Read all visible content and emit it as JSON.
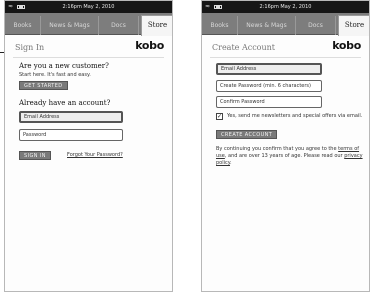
{
  "status": {
    "time": "2:16pm",
    "date": "May 2, 2010"
  },
  "tabs": [
    "Books",
    "News & Mags",
    "Docs",
    "Store"
  ],
  "brand": "kobo",
  "sign_in": {
    "title": "Sign In",
    "new_heading": "Are you a new customer?",
    "new_sub": "Start here. It's fast and easy.",
    "get_started": "GET STARTED",
    "have_heading": "Already have an account?",
    "email_placeholder": "Email Address",
    "password_placeholder": "Password",
    "sign_in_button": "SIGN IN",
    "forgot_link": "Forgot Your Password?"
  },
  "create_account": {
    "title": "Create Account",
    "email_placeholder": "Email Address",
    "password_placeholder": "Create Password (min. 6 characters)",
    "confirm_placeholder": "Confirm Password",
    "newsletter_label": "Yes, send me newsletters and special offers via email.",
    "newsletter_checked": true,
    "create_button": "CREATE ACCOUNT",
    "legal_1": "By continuing you confirm that you agree to the",
    "terms_link": "terms of use",
    "legal_2": ", and are over 13 years of age.",
    "legal_3": "Please read our",
    "privacy_link": "privacy policy",
    "legal_4": "."
  }
}
